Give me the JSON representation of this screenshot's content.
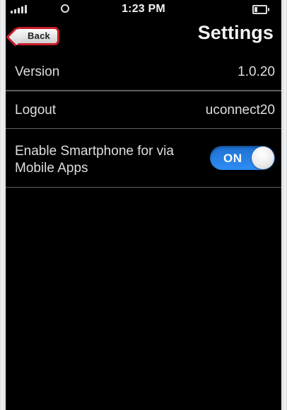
{
  "status_bar": {
    "time": "1:23 PM"
  },
  "navigation": {
    "back_label": "Back",
    "title": "Settings"
  },
  "settings": {
    "version": {
      "label": "Version",
      "value": "1.0.20"
    },
    "logout": {
      "label": "Logout",
      "value": "uconnect20"
    },
    "smartphone": {
      "label": "Enable Smartphone for via Mobile Apps",
      "toggle_state": "ON"
    }
  },
  "colors": {
    "background": "#000000",
    "toggle_on": "#2e8df5",
    "back_button_border": "#c91d2b"
  },
  "icons": {
    "signal": "signal-bars-icon",
    "wifi": "wifi-icon",
    "battery": "battery-icon"
  }
}
